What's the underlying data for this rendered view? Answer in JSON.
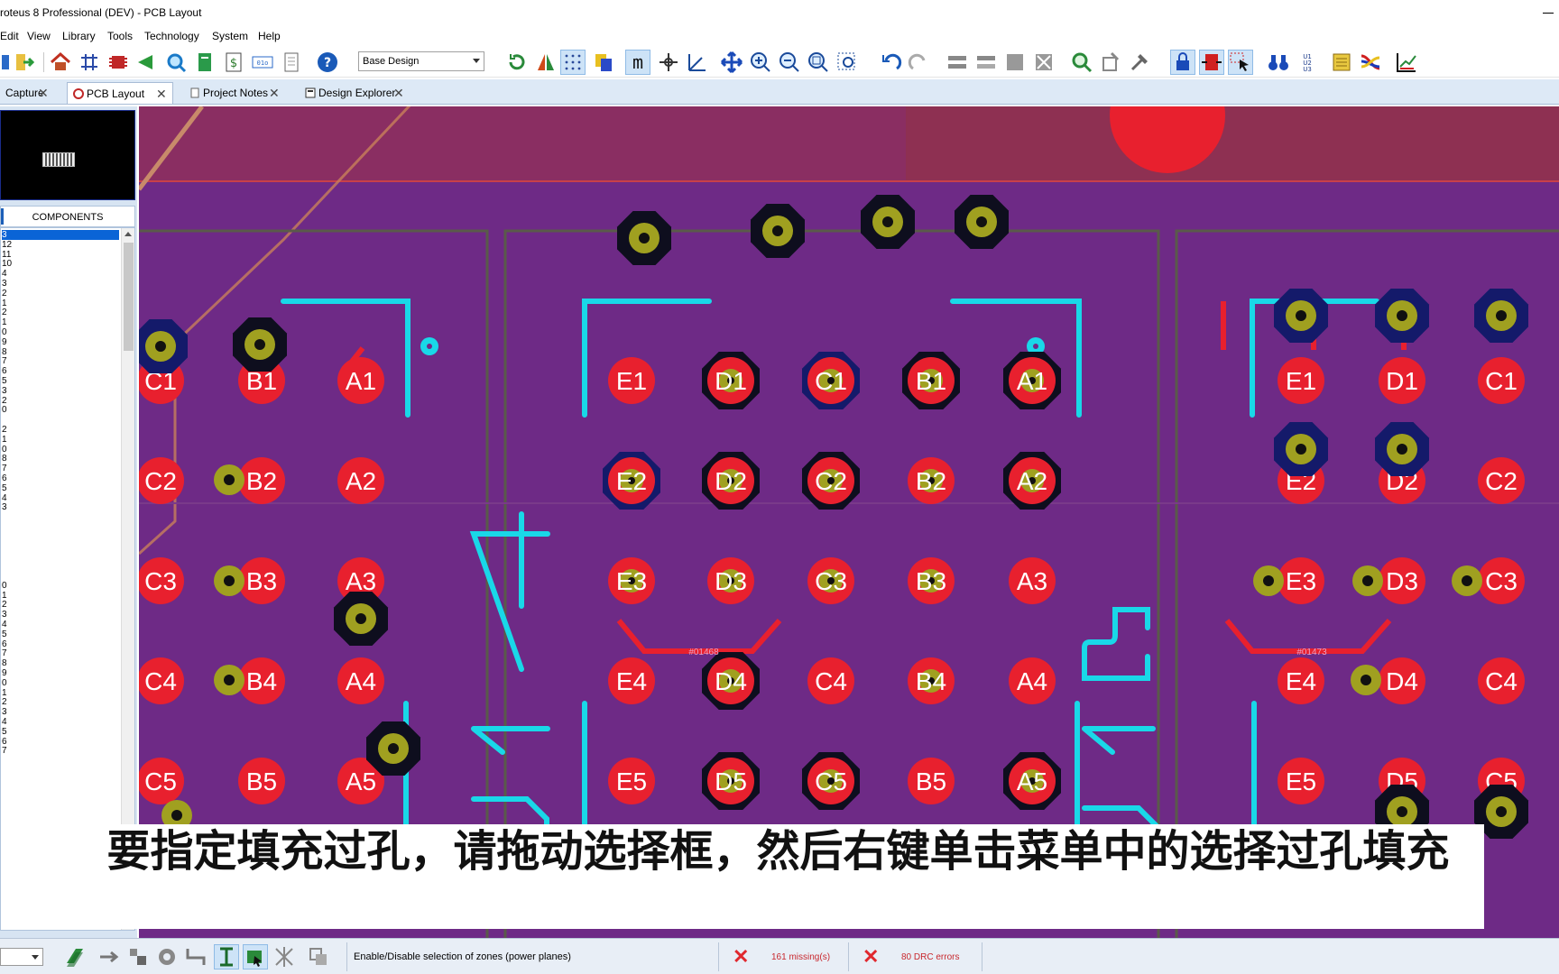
{
  "window": {
    "title": "roteus 8 Professional (DEV) - PCB Layout"
  },
  "menu": [
    "Edit",
    "View",
    "Library",
    "Tools",
    "Technology",
    "System",
    "Help"
  ],
  "toolbar": {
    "layer_value": "Base Design"
  },
  "tabs": [
    {
      "label": "Capture"
    },
    {
      "label": "PCB Layout"
    },
    {
      "label": "Project Notes"
    },
    {
      "label": "Design Explorer"
    }
  ],
  "components_panel": {
    "header": "COMPONENTS",
    "items": [
      "3",
      "12",
      "11",
      "10",
      "4",
      "3",
      "2",
      "1",
      "2",
      "1",
      "0",
      "9",
      "8",
      "7",
      "6",
      "5",
      "3",
      "2",
      "0",
      "2",
      "1",
      "0",
      "8",
      "7",
      "6",
      "5",
      "4",
      "3",
      "0",
      "1",
      "2",
      "3",
      "4",
      "5",
      "6",
      "7",
      "8",
      "9",
      "0",
      "1",
      "2",
      "3",
      "4",
      "5",
      "6",
      "7"
    ]
  },
  "pcb": {
    "pad_labels": {
      "left_group": [
        "C1",
        "B1",
        "A1",
        "C2",
        "B2",
        "A2",
        "C3",
        "B3",
        "A3",
        "C4",
        "B4",
        "A4",
        "C5",
        "B5",
        "A5"
      ],
      "mid_group": [
        "E1",
        "D1",
        "C1",
        "B1",
        "A1",
        "E2",
        "D2",
        "C2",
        "B2",
        "A2",
        "E3",
        "D3",
        "C3",
        "B3",
        "A3",
        "E4",
        "D4",
        "C4",
        "B4",
        "A4",
        "E5",
        "D5",
        "C5",
        "B5",
        "A5"
      ],
      "right_group": [
        "E1",
        "D1",
        "C1",
        "E2",
        "D2",
        "C2",
        "E3",
        "D3",
        "C3",
        "E4",
        "D4",
        "C4",
        "E5",
        "D5",
        "C5"
      ]
    },
    "net_label_mid": "#01468",
    "net_label_right": "#01473",
    "silk_digits": [
      "4",
      "5"
    ],
    "colors": {
      "board": "#6e2a86",
      "pad": "#e8202e",
      "silk": "#19d8e8",
      "trace": "#e8202e",
      "via_ring": "#a0a020"
    }
  },
  "subtitle": "要指定填充过孔，请拖动选择框，然后右键单击菜单中的选择过孔填充",
  "status": {
    "hint": "Enable/Disable selection of zones (power planes)",
    "missing": "161 missing(s)",
    "drc": "80 DRC errors"
  }
}
